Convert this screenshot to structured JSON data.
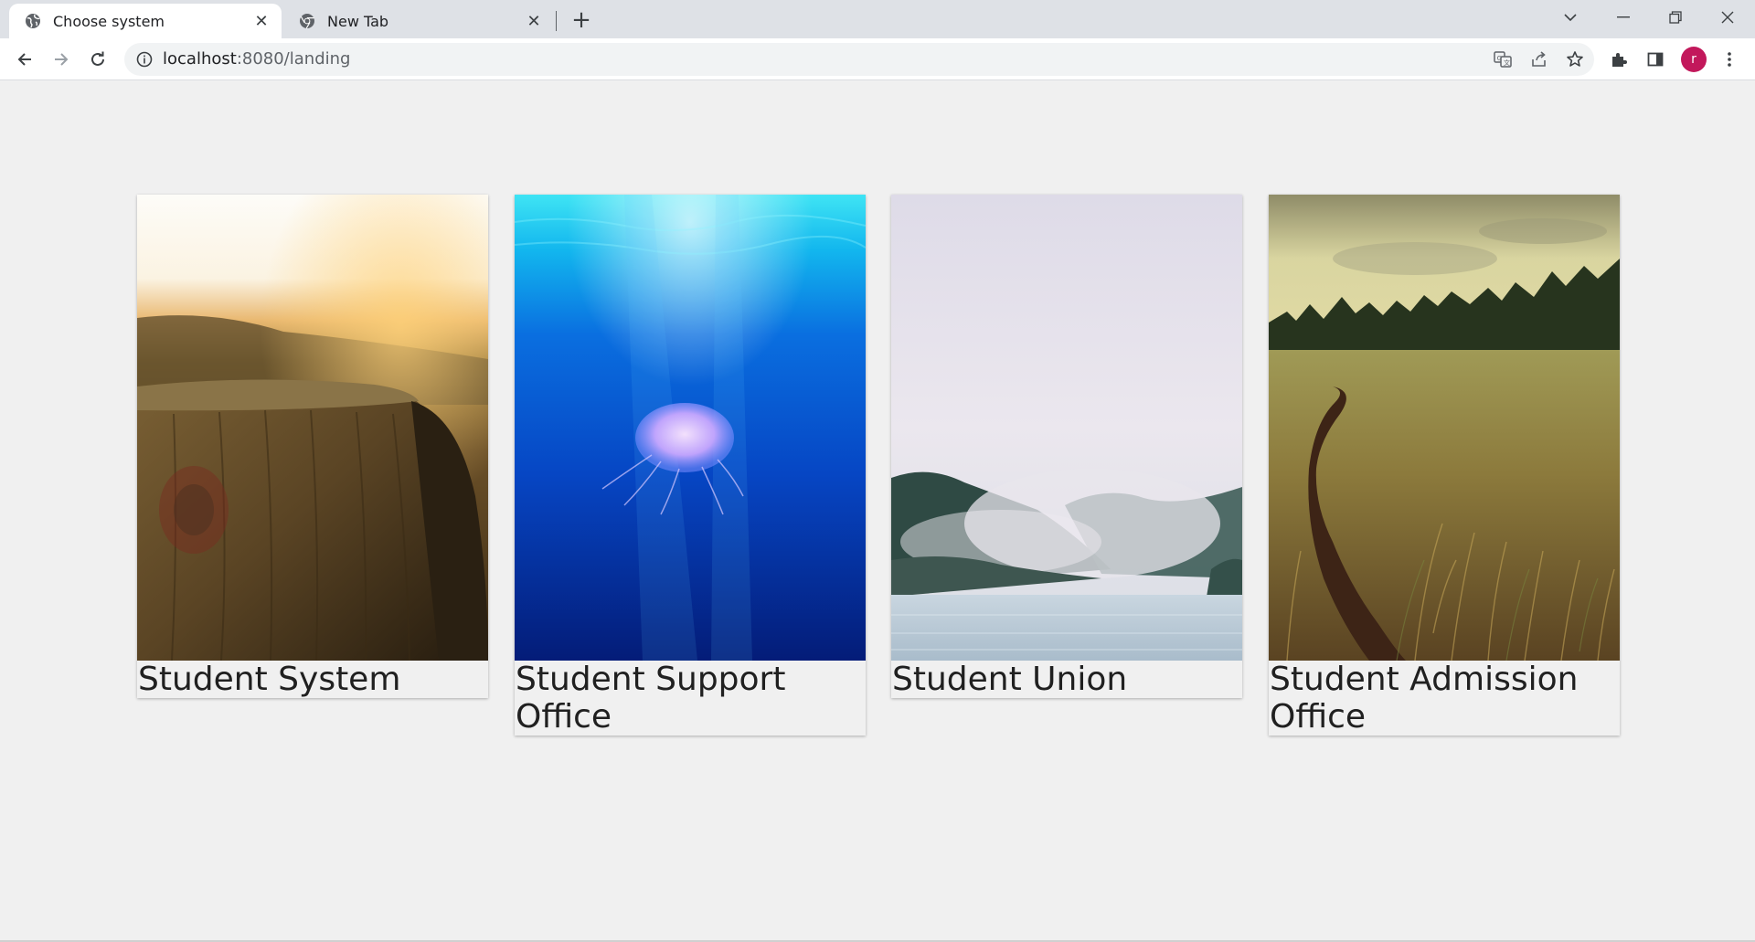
{
  "browser": {
    "tabs": [
      {
        "title": "Choose system",
        "active": true,
        "icon": "globe-icon"
      },
      {
        "title": "New Tab",
        "active": false,
        "icon": "chrome-icon"
      }
    ],
    "url_host": "localhost",
    "url_path": ":8080/landing",
    "profile_initial": "r",
    "profile_color": "#c2185b"
  },
  "cards": [
    {
      "title": "Student System",
      "image": "tree-stump-sunset-photo"
    },
    {
      "title": "Student Support Office",
      "image": "jellyfish-underwater-photo"
    },
    {
      "title": "Student Union",
      "image": "misty-lake-forest-photo"
    },
    {
      "title": "Student Admission Office",
      "image": "meadow-trail-forest-photo"
    }
  ]
}
